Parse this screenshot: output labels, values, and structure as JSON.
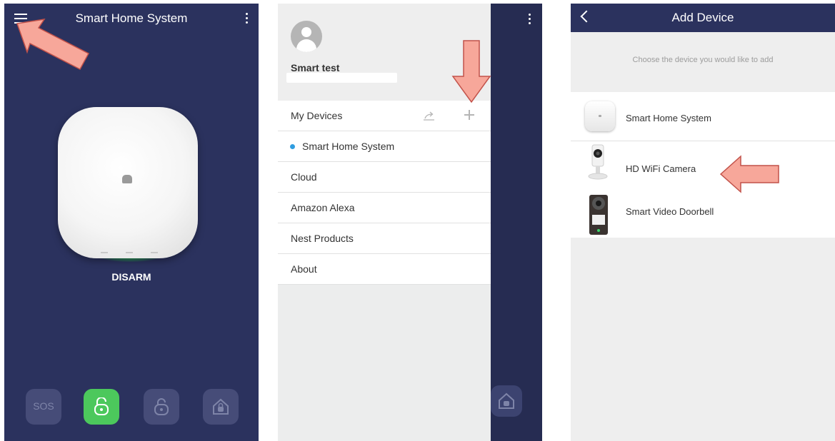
{
  "screen1": {
    "title": "Smart Home System",
    "status": "DISARM",
    "buttons": [
      {
        "label": "SOS",
        "icon": "sos-icon"
      },
      {
        "label": "",
        "icon": "unlock-icon",
        "active": true
      },
      {
        "label": "",
        "icon": "lock-icon"
      },
      {
        "label": "",
        "icon": "home-lock-icon"
      }
    ],
    "colors": {
      "background": "#2b325e",
      "active": "#4cc85c"
    }
  },
  "screen2": {
    "username": "Smart test",
    "menu": [
      {
        "label": "My Devices"
      },
      {
        "label": "Smart Home System",
        "selected": true
      },
      {
        "label": "Cloud"
      },
      {
        "label": "Amazon Alexa"
      },
      {
        "label": "Nest Products"
      },
      {
        "label": "About"
      }
    ],
    "colors": {
      "accent": "#2f9de0"
    }
  },
  "screen3": {
    "title": "Add Device",
    "hint": "Choose the device you would like to add",
    "devices": [
      {
        "name": "Smart Home System",
        "icon": "hub-icon"
      },
      {
        "name": "HD WiFi Camera",
        "icon": "camera-icon"
      },
      {
        "name": "Smart Video Doorbell",
        "icon": "doorbell-icon"
      }
    ]
  },
  "annotation_color": "#f59a8e"
}
